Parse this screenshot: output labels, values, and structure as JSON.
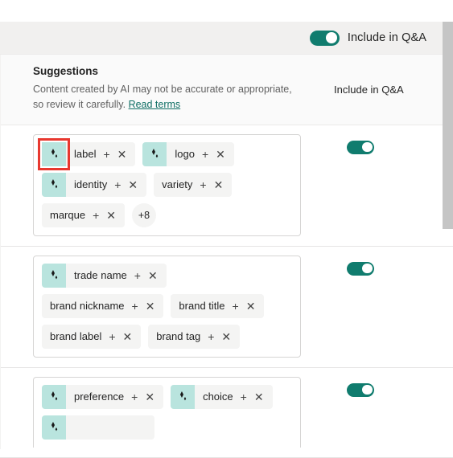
{
  "header": {
    "include_label": "Include in Q&A",
    "toggle_on": true
  },
  "intro": {
    "title": "Suggestions",
    "description": "Content created by AI may not be accurate or appropriate, so review it carefully.",
    "link_label": "Read terms",
    "column_header": "Include in Q&A"
  },
  "icons": {
    "ai_sparkle": "ai-sparkle-icon",
    "plus": "+",
    "close": "✕"
  },
  "colors": {
    "toggle_on": "#107c6e",
    "ai_icon_bg": "#b9e4de",
    "chip_bg": "#f4f4f3",
    "highlight": "#e8382f",
    "link": "#0f6e64"
  },
  "rows": [
    {
      "toggle_on": true,
      "clipped": false,
      "chip_rows": [
        [
          {
            "label": "label",
            "ai": true,
            "highlighted": true,
            "plus": "+",
            "close": "✕"
          },
          {
            "label": "logo",
            "ai": true,
            "highlighted": false,
            "plus": "+",
            "close": "✕"
          }
        ],
        [
          {
            "label": "identity",
            "ai": true,
            "highlighted": false,
            "plus": "+",
            "close": "✕"
          },
          {
            "label": "variety",
            "ai": false,
            "highlighted": false,
            "plus": "+",
            "close": "✕"
          }
        ],
        [
          {
            "label": "marque",
            "ai": false,
            "highlighted": false,
            "plus": "+",
            "close": "✕"
          },
          {
            "more_badge": "+8"
          }
        ]
      ]
    },
    {
      "toggle_on": true,
      "clipped": false,
      "chip_rows": [
        [
          {
            "label": "trade name",
            "ai": true,
            "highlighted": false,
            "plus": "+",
            "close": "✕"
          }
        ],
        [
          {
            "label": "brand nickname",
            "ai": false,
            "highlighted": false,
            "plus": "+",
            "close": "✕"
          },
          {
            "label": "brand title",
            "ai": false,
            "highlighted": false,
            "plus": "+",
            "close": "✕"
          }
        ],
        [
          {
            "label": "brand label",
            "ai": false,
            "highlighted": false,
            "plus": "+",
            "close": "✕"
          },
          {
            "label": "brand tag",
            "ai": false,
            "highlighted": false,
            "plus": "+",
            "close": "✕"
          }
        ]
      ]
    },
    {
      "toggle_on": true,
      "clipped": true,
      "chip_rows": [
        [
          {
            "label": "preference",
            "ai": true,
            "highlighted": false,
            "plus": "+",
            "close": "✕"
          },
          {
            "label": "choice",
            "ai": true,
            "highlighted": false,
            "plus": "+",
            "close": "✕"
          }
        ],
        [
          {
            "label": "",
            "ai": true,
            "highlighted": false,
            "plus": "",
            "close": ""
          }
        ]
      ]
    }
  ]
}
